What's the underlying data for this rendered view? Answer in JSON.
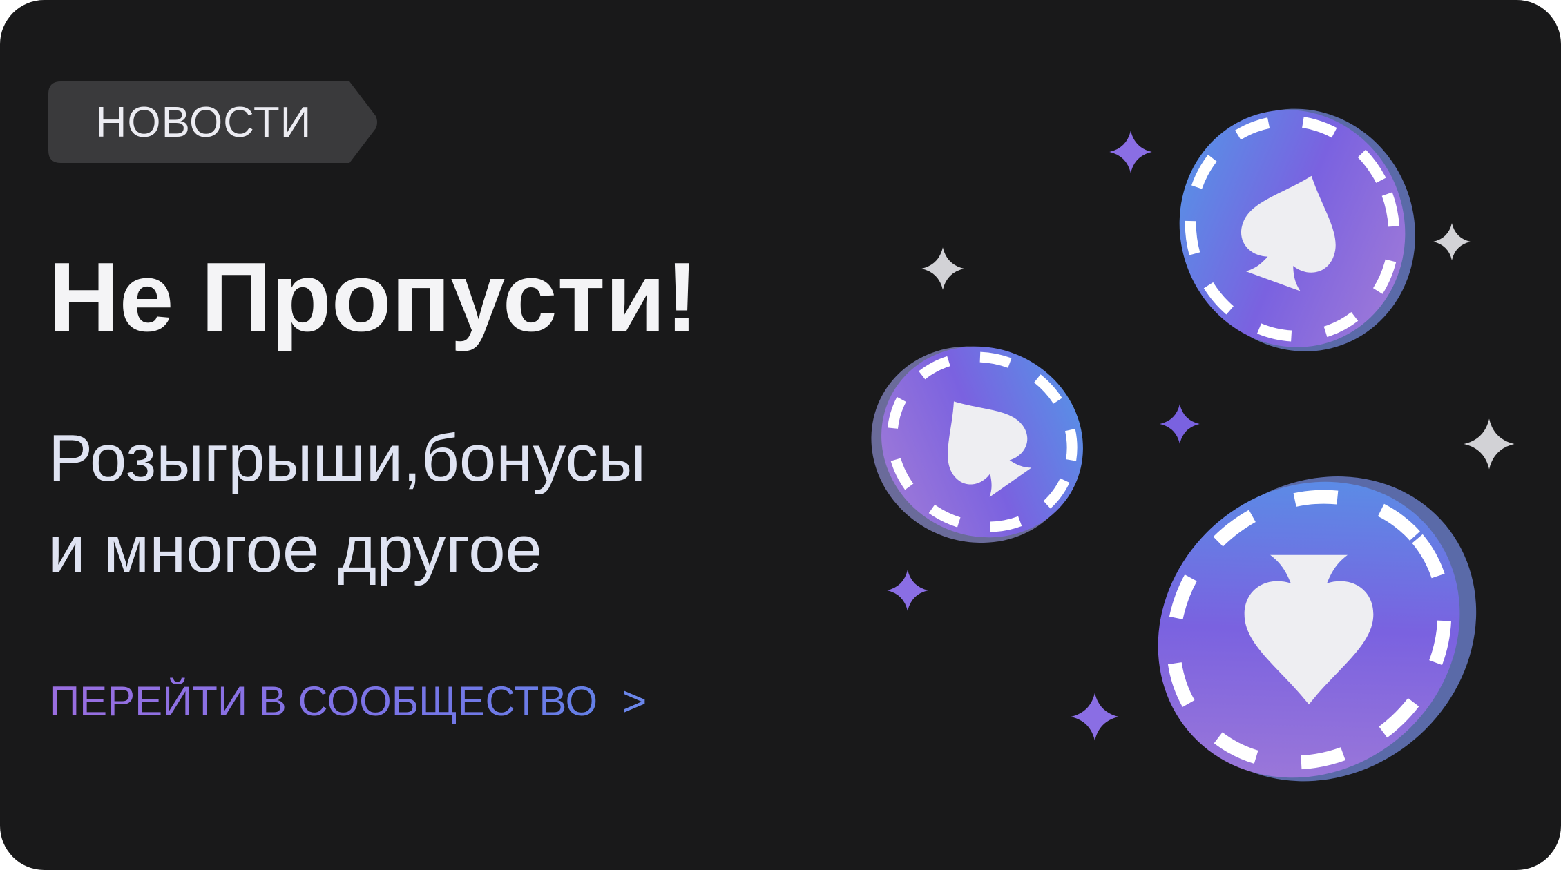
{
  "badge": {
    "label": "НОВОСТИ"
  },
  "headline": "Не Пропусти!",
  "subtitle": {
    "line1": "Розыгрыши,бонусы",
    "line2": "и многое другое"
  },
  "cta": {
    "label": "ПЕРЕЙТИ В СООБЩЕСТВО",
    "arrow": ">"
  },
  "colors": {
    "background": "#19191a",
    "badge_fill": "#3a3a3c",
    "chip_blue": "#4f9ce8",
    "chip_purple": "#7a62e0",
    "chip_violet": "#a77fd6",
    "sparkle_gray": "#d2d2d6",
    "sparkle_purple": "#8a6ee4"
  },
  "icons": [
    "spade-icon",
    "sparkle-icon",
    "chevron-right-icon"
  ]
}
